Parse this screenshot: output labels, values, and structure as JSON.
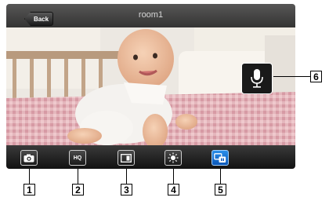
{
  "header": {
    "back_label": "Back",
    "camera_name": "room1"
  },
  "controls": {
    "mic": {
      "icon": "microphone-icon"
    },
    "toolbar": [
      {
        "name": "snapshot",
        "icon": "camera-icon"
      },
      {
        "name": "quality",
        "icon": "hq-icon",
        "label": "HQ"
      },
      {
        "name": "view",
        "icon": "display-icon"
      },
      {
        "name": "brightness",
        "icon": "brightness-icon"
      },
      {
        "name": "intercom",
        "icon": "intercom-icon"
      }
    ]
  },
  "callouts": [
    "1",
    "2",
    "3",
    "4",
    "5",
    "6"
  ],
  "colors": {
    "active_button": "#1a7ad4",
    "bar": "#1e1e1e"
  }
}
